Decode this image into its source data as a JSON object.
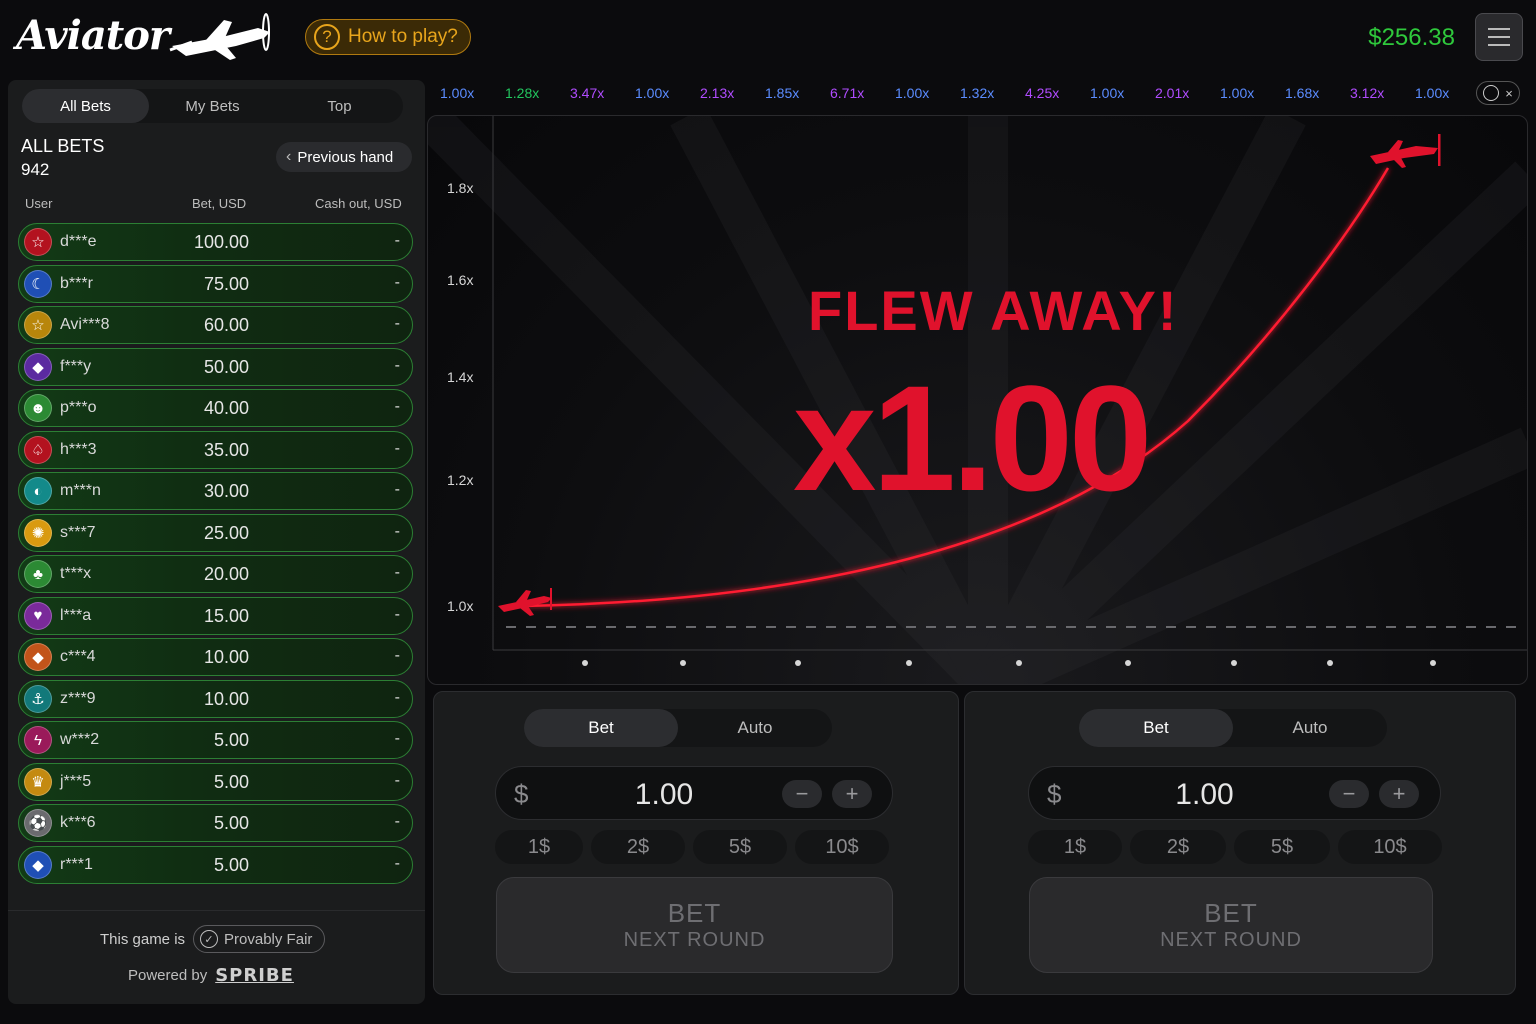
{
  "header": {
    "logo_text": "Aviator",
    "how_to_play": "How to play?",
    "how_to_play_icon": "question-circle-icon",
    "balance": "$256.38"
  },
  "sidebar": {
    "tabs": [
      {
        "label": "All Bets",
        "active": true
      },
      {
        "label": "My Bets",
        "active": false
      },
      {
        "label": "Top",
        "active": false
      }
    ],
    "title": "ALL BETS",
    "count": "942",
    "previous_hand": "Previous hand",
    "columns": {
      "user": "User",
      "bet": "Bet, USD",
      "cashout": "Cash out, USD"
    },
    "rows": [
      {
        "user": "d***e",
        "bet": "100.00",
        "cashout": "-",
        "icon": "star-icon",
        "color": "#b3121f",
        "glyph": "☆"
      },
      {
        "user": "b***r",
        "bet": "75.00",
        "cashout": "-",
        "icon": "moon-icon",
        "color": "#1f4fb5",
        "glyph": "☾"
      },
      {
        "user": "Avi***8",
        "bet": "60.00",
        "cashout": "-",
        "icon": "star-icon",
        "color": "#b8860b",
        "glyph": "☆"
      },
      {
        "user": "f***y",
        "bet": "50.00",
        "cashout": "-",
        "icon": "diamond-icon",
        "color": "#5b2aa0",
        "glyph": "◆"
      },
      {
        "user": "p***o",
        "bet": "40.00",
        "cashout": "-",
        "icon": "mask-icon",
        "color": "#2c8a34",
        "glyph": "☻"
      },
      {
        "user": "h***3",
        "bet": "35.00",
        "cashout": "-",
        "icon": "spade-icon",
        "color": "#b3121f",
        "glyph": "♤"
      },
      {
        "user": "m***n",
        "bet": "30.00",
        "cashout": "-",
        "icon": "planet-icon",
        "color": "#138a8a",
        "glyph": "◐"
      },
      {
        "user": "s***7",
        "bet": "25.00",
        "cashout": "-",
        "icon": "sun-icon",
        "color": "#d99a10",
        "glyph": "✺"
      },
      {
        "user": "t***x",
        "bet": "20.00",
        "cashout": "-",
        "icon": "clover-icon",
        "color": "#2c8a34",
        "glyph": "♣"
      },
      {
        "user": "l***a",
        "bet": "15.00",
        "cashout": "-",
        "icon": "heart-icon",
        "color": "#7a2a9a",
        "glyph": "♥"
      },
      {
        "user": "c***4",
        "bet": "10.00",
        "cashout": "-",
        "icon": "diamond-icon",
        "color": "#c2541a",
        "glyph": "◆"
      },
      {
        "user": "z***9",
        "bet": "10.00",
        "cashout": "-",
        "icon": "anchor-icon",
        "color": "#12797a",
        "glyph": "⚓"
      },
      {
        "user": "w***2",
        "bet": "5.00",
        "cashout": "-",
        "icon": "lightning-icon",
        "color": "#9a1a5a",
        "glyph": "ϟ"
      },
      {
        "user": "j***5",
        "bet": "5.00",
        "cashout": "-",
        "icon": "crown-icon",
        "color": "#c48a10",
        "glyph": "♛"
      },
      {
        "user": "k***6",
        "bet": "5.00",
        "cashout": "-",
        "icon": "soccer-ball-icon",
        "color": "#6a6a6e",
        "glyph": "⚽"
      },
      {
        "user": "r***1",
        "bet": "5.00",
        "cashout": "-",
        "icon": "diamond-icon",
        "color": "#1f4fb5",
        "glyph": "◆"
      }
    ],
    "fair_text": "This game is",
    "provably_fair": "Provably Fair",
    "powered_by": "Powered by",
    "brand": "SPRIBE"
  },
  "history": [
    {
      "value": "1.00x",
      "color": "#5b8cff"
    },
    {
      "value": "1.28x",
      "color": "#22c55e"
    },
    {
      "value": "3.47x",
      "color": "#b04cff"
    },
    {
      "value": "1.00x",
      "color": "#5b8cff"
    },
    {
      "value": "2.13x",
      "color": "#b04cff"
    },
    {
      "value": "1.85x",
      "color": "#5b8cff"
    },
    {
      "value": "6.71x",
      "color": "#b04cff"
    },
    {
      "value": "1.00x",
      "color": "#5b8cff"
    },
    {
      "value": "1.32x",
      "color": "#5b8cff"
    },
    {
      "value": "4.25x",
      "color": "#b04cff"
    },
    {
      "value": "1.00x",
      "color": "#5b8cff"
    },
    {
      "value": "2.01x",
      "color": "#b04cff"
    },
    {
      "value": "1.00x",
      "color": "#5b8cff"
    },
    {
      "value": "1.68x",
      "color": "#5b8cff"
    },
    {
      "value": "3.12x",
      "color": "#b04cff"
    },
    {
      "value": "1.00x",
      "color": "#5b8cff"
    }
  ],
  "game": {
    "status": "FLEW AWAY!",
    "multiplier": "x1.00",
    "y_axis": [
      "1.8x",
      "1.6x",
      "1.4x",
      "1.2x",
      "1.0x"
    ],
    "accent": "#e0122c"
  },
  "bet_panels": [
    {
      "tabs": [
        {
          "label": "Bet",
          "active": true
        },
        {
          "label": "Auto",
          "active": false
        }
      ],
      "currency": "$",
      "amount": "1.00",
      "minus": "−",
      "plus": "+",
      "chips": [
        "1$",
        "2$",
        "5$",
        "10$"
      ],
      "button_line1": "BET",
      "button_line2": "NEXT ROUND"
    },
    {
      "tabs": [
        {
          "label": "Bet",
          "active": true
        },
        {
          "label": "Auto",
          "active": false
        }
      ],
      "currency": "$",
      "amount": "1.00",
      "minus": "−",
      "plus": "+",
      "chips": [
        "1$",
        "2$",
        "5$",
        "10$"
      ],
      "button_line1": "BET",
      "button_line2": "NEXT ROUND"
    }
  ]
}
